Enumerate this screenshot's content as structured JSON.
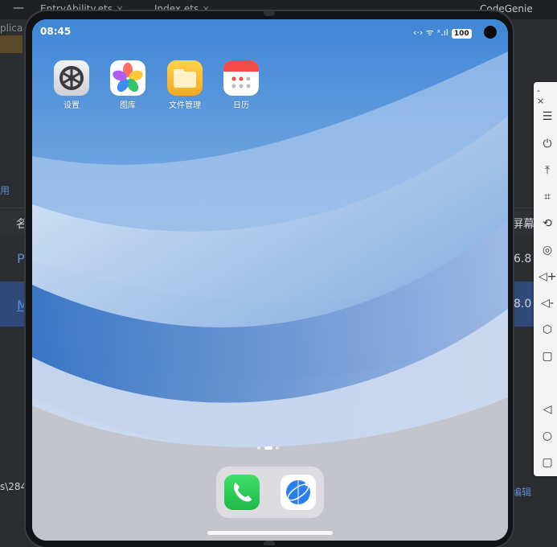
{
  "ide": {
    "minimize": "—",
    "tabs": [
      {
        "label": "EntryAbility.ets",
        "close": "×"
      },
      {
        "label": "Index.ets",
        "close": "×"
      }
    ],
    "codegenie": "CodeGenie",
    "applica_fragment": "plica",
    "left_edge_fragment": "用",
    "table_header_fragment": "名",
    "table_header_right_fragment": "屏幕",
    "row1_left": "P",
    "row1_right": "6.8",
    "row2_left": "M",
    "row2_right": "8.0",
    "bottom_path_fragment": "s\\284",
    "edit_link": "编辑"
  },
  "emulator_toolbar": {
    "window_controls": "- ×",
    "tools": [
      {
        "name": "menu-icon",
        "glyph": "☰"
      },
      {
        "name": "power-icon",
        "glyph": "⏻"
      },
      {
        "name": "pin-top-icon",
        "glyph": "⤒"
      },
      {
        "name": "crop-icon",
        "glyph": "⌗"
      },
      {
        "name": "rotate-icon",
        "glyph": "⟲"
      },
      {
        "name": "screenshot-icon",
        "glyph": "◎"
      },
      {
        "name": "volume-up-icon",
        "glyph": "◁+"
      },
      {
        "name": "volume-down-icon",
        "glyph": "◁-"
      },
      {
        "name": "fold-icon",
        "glyph": "⬡"
      },
      {
        "name": "square-icon",
        "glyph": "▢"
      },
      {
        "name": "back-icon",
        "glyph": "◁"
      },
      {
        "name": "home-icon",
        "glyph": "○"
      },
      {
        "name": "recents-icon",
        "glyph": "▢"
      }
    ]
  },
  "status_bar": {
    "time": "08:45",
    "icons_text": "‹·› ᯤ ˣ.ıl",
    "battery": "100"
  },
  "apps": [
    {
      "label": "设置",
      "icon": "settings-icon"
    },
    {
      "label": "图库",
      "icon": "gallery-icon"
    },
    {
      "label": "文件管理",
      "icon": "files-icon"
    },
    {
      "label": "日历",
      "icon": "calendar-icon"
    }
  ],
  "page_indicator": {
    "count": 3,
    "active": 1
  },
  "dock": [
    {
      "icon": "phone-icon"
    },
    {
      "icon": "browser-icon"
    }
  ],
  "colors": {
    "ide_bg": "#2b2d30",
    "ide_selected_row": "#2f4a7a",
    "link_blue": "#5a8dd6",
    "wallpaper_blue": "#3f86d6"
  }
}
